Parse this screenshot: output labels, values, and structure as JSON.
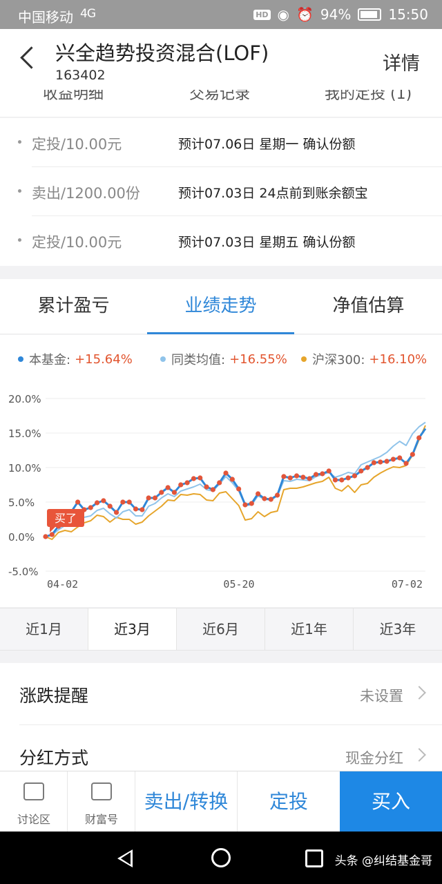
{
  "status_bar": {
    "carrier": "中国移动",
    "network": "4G",
    "battery": "94%",
    "time": "15:50"
  },
  "header": {
    "title": "兴全趋势投资混合(LOF)",
    "code": "163402",
    "detail_label": "详情"
  },
  "tabs_peek": [
    "收益明细",
    "交易记录",
    "我的定投 (1)"
  ],
  "transactions": [
    {
      "left": "定投/10.00元",
      "right": "预计07.06日 星期一 确认份额"
    },
    {
      "left": "卖出/1200.00份",
      "right": "预计07.03日 24点前到账余额宝"
    },
    {
      "left": "定投/10.00元",
      "right": "预计07.03日 星期五 确认份额"
    }
  ],
  "perf_tabs": [
    "累计盈亏",
    "业绩走势",
    "净值估算"
  ],
  "legend": [
    {
      "name": "本基金:",
      "value": "+15.64%",
      "color": "#2f87d8"
    },
    {
      "name": "同类均值:",
      "value": "+16.55%",
      "color": "#8fc3ea"
    },
    {
      "name": "沪深300:",
      "value": "+16.10%",
      "color": "#e6a52b"
    }
  ],
  "chart_data": {
    "type": "line",
    "y_ticks": [
      "20.0%",
      "15.0%",
      "10.0%",
      "5.0%",
      "0.0%",
      "-5.0%"
    ],
    "x_ticks": [
      "04-02",
      "05-20",
      "07-02"
    ],
    "ylim": [
      -5,
      20
    ],
    "buy_marker": "买了",
    "series": [
      {
        "name": "本基金",
        "color": "#2f87d8",
        "markers": "#e2553a",
        "values": [
          0.0,
          0.3,
          1.5,
          2.5,
          3.6,
          5.0,
          3.9,
          4.2,
          4.9,
          5.2,
          4.4,
          3.5,
          5.0,
          5.0,
          4.0,
          3.9,
          5.6,
          5.6,
          6.4,
          7.1,
          6.4,
          7.5,
          7.8,
          8.4,
          8.5,
          7.2,
          6.8,
          7.8,
          9.2,
          8.3,
          6.9,
          4.6,
          4.8,
          6.2,
          5.5,
          5.4,
          6.0,
          8.7,
          8.5,
          8.8,
          8.6,
          8.4,
          9.0,
          9.1,
          9.5,
          8.2,
          8.2,
          8.5,
          8.8,
          9.5,
          10.0,
          10.7,
          10.8,
          10.9,
          11.2,
          11.4,
          10.6,
          11.9,
          14.3,
          15.64
        ]
      },
      {
        "name": "同类均值",
        "color": "#8fc3ea",
        "values": [
          0.0,
          0.2,
          1.0,
          1.6,
          2.4,
          3.6,
          2.8,
          3.0,
          3.8,
          4.1,
          3.3,
          2.7,
          3.6,
          3.9,
          3.0,
          3.0,
          4.4,
          4.8,
          5.6,
          6.2,
          5.8,
          6.6,
          6.9,
          7.2,
          7.6,
          6.8,
          6.6,
          7.6,
          8.7,
          7.8,
          6.6,
          4.5,
          4.6,
          5.9,
          5.4,
          5.3,
          5.9,
          8.1,
          8.0,
          8.3,
          8.2,
          8.1,
          8.7,
          9.0,
          9.3,
          8.6,
          8.9,
          9.3,
          9.1,
          10.4,
          10.8,
          11.2,
          11.6,
          12.2,
          13.1,
          13.8,
          13.2,
          14.9,
          15.9,
          16.55
        ]
      },
      {
        "name": "沪深300",
        "color": "#e6a52b",
        "values": [
          0.0,
          -0.4,
          0.6,
          0.9,
          0.7,
          1.4,
          2.0,
          2.3,
          3.1,
          2.9,
          2.1,
          2.8,
          2.5,
          2.5,
          1.8,
          2.1,
          3.0,
          3.7,
          4.4,
          5.3,
          5.2,
          6.1,
          6.0,
          6.2,
          6.1,
          5.3,
          5.2,
          6.3,
          6.5,
          5.5,
          4.5,
          2.4,
          2.6,
          3.6,
          2.9,
          3.5,
          3.7,
          6.8,
          7.0,
          7.0,
          7.2,
          7.5,
          7.8,
          8.0,
          8.6,
          7.0,
          6.6,
          7.4,
          6.4,
          7.5,
          7.7,
          8.6,
          9.2,
          9.7,
          10.1,
          10.0,
          10.3,
          11.8,
          14.0,
          16.1
        ]
      }
    ]
  },
  "period_tabs": [
    "近1月",
    "近3月",
    "近6月",
    "近1年",
    "近3年"
  ],
  "settings": [
    {
      "label": "涨跌提醒",
      "value": "未设置"
    },
    {
      "label": "分红方式",
      "value": "现金分红"
    }
  ],
  "action_bar": {
    "icons": [
      {
        "label": "讨论区"
      },
      {
        "label": "财富号"
      }
    ],
    "sell": "卖出/转换",
    "plan": "定投",
    "buy": "买入"
  },
  "watermark": "头条 @纠结基金哥"
}
